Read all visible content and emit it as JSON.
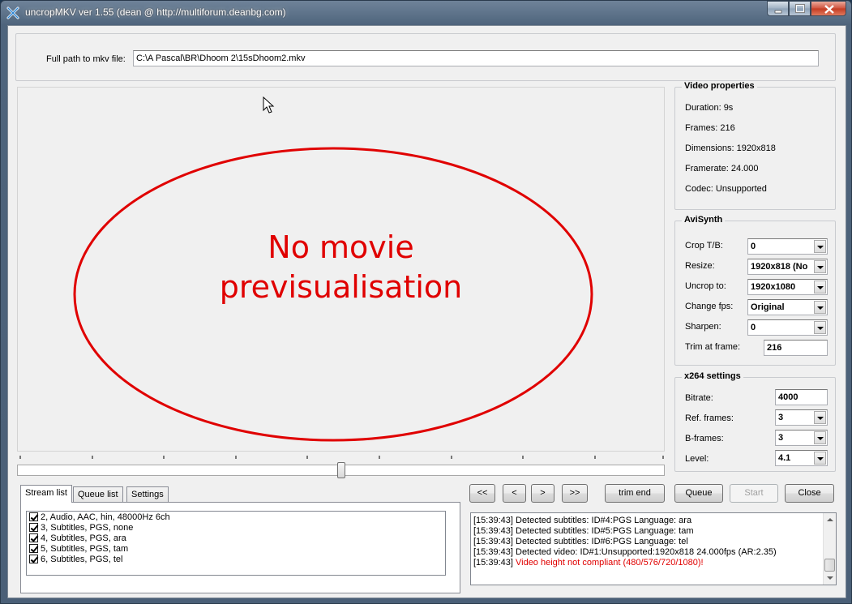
{
  "window": {
    "title": "uncropMKV ver 1.55 (dean @ http://multiforum.deanbg.com)"
  },
  "path": {
    "label": "Full path to mkv file:",
    "value": "C:\\A Pascal\\BR\\Dhoom 2\\15sDhoom2.mkv"
  },
  "preview": {
    "line1": "No movie",
    "line2": "previsualisation",
    "ellipse_color": "#e00000"
  },
  "video_properties": {
    "title": "Video properties",
    "duration": "Duration: 9s",
    "frames": "Frames: 216",
    "dimensions": "Dimensions: 1920x818",
    "framerate": "Framerate: 24.000",
    "codec": "Codec: Unsupported"
  },
  "avisynth": {
    "title": "AviSynth",
    "crop_label": "Crop T/B:",
    "crop_value": "0",
    "resize_label": "Resize:",
    "resize_value": "1920x818 (No",
    "uncrop_label": "Uncrop to:",
    "uncrop_value": "1920x1080",
    "fps_label": "Change fps:",
    "fps_value": "Original",
    "sharpen_label": "Sharpen:",
    "sharpen_value": "0",
    "trim_label": "Trim at frame:",
    "trim_value": "216"
  },
  "x264": {
    "title": "x264 settings",
    "bitrate_label": "Bitrate:",
    "bitrate_value": "4000",
    "ref_label": "Ref. frames:",
    "ref_value": "3",
    "bframes_label": "B-frames:",
    "bframes_value": "3",
    "level_label": "Level:",
    "level_value": "4.1"
  },
  "tabs": [
    "Stream list",
    "Queue list",
    "Settings"
  ],
  "streams": [
    "2, Audio, AAC, hin, 48000Hz 6ch",
    "3, Subtitles, PGS, none",
    "4, Subtitles, PGS, ara",
    "5, Subtitles, PGS, tam",
    "6, Subtitles, PGS, tel"
  ],
  "controls": {
    "rewind_fast": "<<",
    "rewind": "<",
    "forward": ">",
    "forward_fast": ">>",
    "trim_end": "trim end",
    "queue": "Queue",
    "start": "Start",
    "close": "Close"
  },
  "log": [
    {
      "ts": "[15:39:43]",
      "msg": " Detected subtitles: ID#4:PGS Language: ara"
    },
    {
      "ts": "[15:39:43]",
      "msg": " Detected subtitles: ID#5:PGS Language: tam"
    },
    {
      "ts": "[15:39:43]",
      "msg": " Detected subtitles: ID#6:PGS Language: tel"
    },
    {
      "ts": "[15:39:43]",
      "msg": " Detected video: ID#1:Unsupported:1920x818 24.000fps (AR:2.35)"
    },
    {
      "ts": "[15:39:43]",
      "msg": " Video height not compliant (480/576/720/1080)!"
    }
  ],
  "slider": {
    "position_fraction": 0.5
  }
}
